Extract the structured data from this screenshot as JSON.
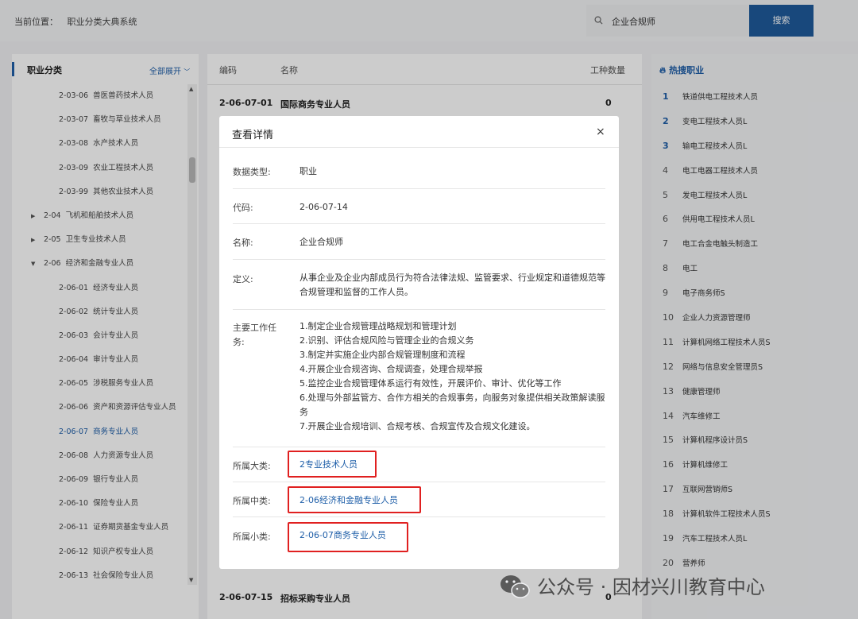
{
  "header": {
    "breadcrumb_prefix": "当前位置：",
    "breadcrumb_current": "职业分类大典系统",
    "search_value": "企业合规师",
    "search_button": "搜索"
  },
  "left": {
    "title": "职业分类",
    "expand_all": "全部展开",
    "items": [
      {
        "code": "2-03-06",
        "name": "兽医兽药技术人员",
        "level": 3
      },
      {
        "code": "2-03-07",
        "name": "畜牧与草业技术人员",
        "level": 3
      },
      {
        "code": "2-03-08",
        "name": "水产技术人员",
        "level": 3
      },
      {
        "code": "2-03-09",
        "name": "农业工程技术人员",
        "level": 3
      },
      {
        "code": "2-03-99",
        "name": "其他农业技术人员",
        "level": 3
      },
      {
        "code": "2-04",
        "name": "飞机和船舶技术人员",
        "level": 2,
        "arrow": "▶"
      },
      {
        "code": "2-05",
        "name": "卫生专业技术人员",
        "level": 2,
        "arrow": "▶"
      },
      {
        "code": "2-06",
        "name": "经济和金融专业人员",
        "level": 2,
        "arrow": "▼"
      },
      {
        "code": "2-06-01",
        "name": "经济专业人员",
        "level": 3
      },
      {
        "code": "2-06-02",
        "name": "统计专业人员",
        "level": 3
      },
      {
        "code": "2-06-03",
        "name": "会计专业人员",
        "level": 3
      },
      {
        "code": "2-06-04",
        "name": "审计专业人员",
        "level": 3
      },
      {
        "code": "2-06-05",
        "name": "涉税服务专业人员",
        "level": 3
      },
      {
        "code": "2-06-06",
        "name": "资产和资源评估专业人员",
        "level": 3
      },
      {
        "code": "2-06-07",
        "name": "商务专业人员",
        "level": 3,
        "selected": true
      },
      {
        "code": "2-06-08",
        "name": "人力资源专业人员",
        "level": 3
      },
      {
        "code": "2-06-09",
        "name": "银行专业人员",
        "level": 3
      },
      {
        "code": "2-06-10",
        "name": "保险专业人员",
        "level": 3
      },
      {
        "code": "2-06-11",
        "name": "证券期货基金专业人员",
        "level": 3
      },
      {
        "code": "2-06-12",
        "name": "知识产权专业人员",
        "level": 3
      },
      {
        "code": "2-06-13",
        "name": "社会保险专业人员",
        "level": 3
      }
    ]
  },
  "main": {
    "col_code": "编码",
    "col_name": "名称",
    "col_count": "工种数量",
    "first_row": {
      "code": "2-06-07-01",
      "name": "国际商务专业人员",
      "count": "0"
    },
    "last_row": {
      "code": "2-06-07-15",
      "name": "招标采购专业人员",
      "count": "0"
    }
  },
  "hot": {
    "title": "热搜职业",
    "items": [
      {
        "rank": "1",
        "name": "铁道供电工程技术人员"
      },
      {
        "rank": "2",
        "name": "变电工程技术人员L"
      },
      {
        "rank": "3",
        "name": "输电工程技术人员L"
      },
      {
        "rank": "4",
        "name": "电工电器工程技术人员"
      },
      {
        "rank": "5",
        "name": "发电工程技术人员L"
      },
      {
        "rank": "6",
        "name": "供用电工程技术人员L"
      },
      {
        "rank": "7",
        "name": "电工合金电触头制造工"
      },
      {
        "rank": "8",
        "name": "电工"
      },
      {
        "rank": "9",
        "name": "电子商务师S"
      },
      {
        "rank": "10",
        "name": "企业人力资源管理师"
      },
      {
        "rank": "11",
        "name": "计算机网络工程技术人员S"
      },
      {
        "rank": "12",
        "name": "网络与信息安全管理员S"
      },
      {
        "rank": "13",
        "name": "健康管理师"
      },
      {
        "rank": "14",
        "name": "汽车维修工"
      },
      {
        "rank": "15",
        "name": "计算机程序设计员S"
      },
      {
        "rank": "16",
        "name": "计算机维修工"
      },
      {
        "rank": "17",
        "name": "互联网营销师S"
      },
      {
        "rank": "18",
        "name": "计算机软件工程技术人员S"
      },
      {
        "rank": "19",
        "name": "汽车工程技术人员L"
      },
      {
        "rank": "20",
        "name": "营养师"
      }
    ]
  },
  "modal": {
    "title": "查看详情",
    "close": "×",
    "type_label": "数据类型:",
    "type_value": "职业",
    "code_label": "代码:",
    "code_value": "2-06-07-14",
    "name_label": "名称:",
    "name_value": "企业合规师",
    "def_label": "定义:",
    "def_value": "从事企业及企业内部成员行为符合法律法规、监管要求、行业规定和道德规范等合规管理和监督的工作人员。",
    "tasks_label_1": "主要工作任",
    "tasks_label_2": "务:",
    "tasks": [
      "1.制定企业合规管理战略规划和管理计划",
      "2.识别、评估合规风险与管理企业的合规义务",
      "3.制定并实施企业内部合规管理制度和流程",
      "4.开展企业合规咨询、合规调查，处理合规举报",
      "5.监控企业合规管理体系运行有效性，开展评价、审计、优化等工作",
      "6.处理与外部监管方、合作方相关的合规事务，向服务对象提供相关政策解读服务",
      "7.开展企业合规培训、合规考核、合规宣传及合规文化建设。"
    ],
    "major_label": "所属大类:",
    "major_value": "2专业技术人员",
    "middle_label": "所属中类:",
    "middle_value": "2-06经济和金融专业人员",
    "minor_label": "所属小类:",
    "minor_value": "2-06-07商务专业人员"
  },
  "watermark": "公众号 · 因材兴川教育中心"
}
